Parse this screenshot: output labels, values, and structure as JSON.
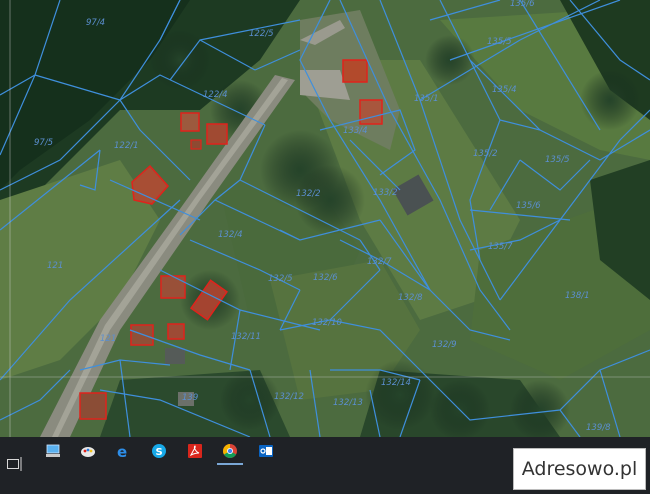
{
  "parcels": [
    "97/4",
    "122/5",
    "135/6",
    "135/5",
    "135/4",
    "135/1",
    "122/4",
    "97/5",
    "122/1",
    "133/4",
    "135/2",
    "135/5",
    "133/2",
    "135/6",
    "132/2",
    "135/7",
    "132/4",
    "121",
    "132/7",
    "132/5",
    "132/6",
    "138/1",
    "132/8",
    "132/10",
    "132/11",
    "132/9",
    "132/14",
    "132/12",
    "132/13",
    "139/8",
    "139",
    "121"
  ],
  "taskbar": {
    "icons": [
      "computer-icon",
      "paint-icon",
      "edge-icon",
      "skype-icon",
      "acrobat-icon",
      "chrome-icon",
      "outlook-icon"
    ],
    "active": "chrome-icon"
  },
  "watermark": "Adresowo.pl",
  "colors": {
    "boundary": "#3f8fdc",
    "building": "#e0231c",
    "taskbar": "#1f2226"
  }
}
